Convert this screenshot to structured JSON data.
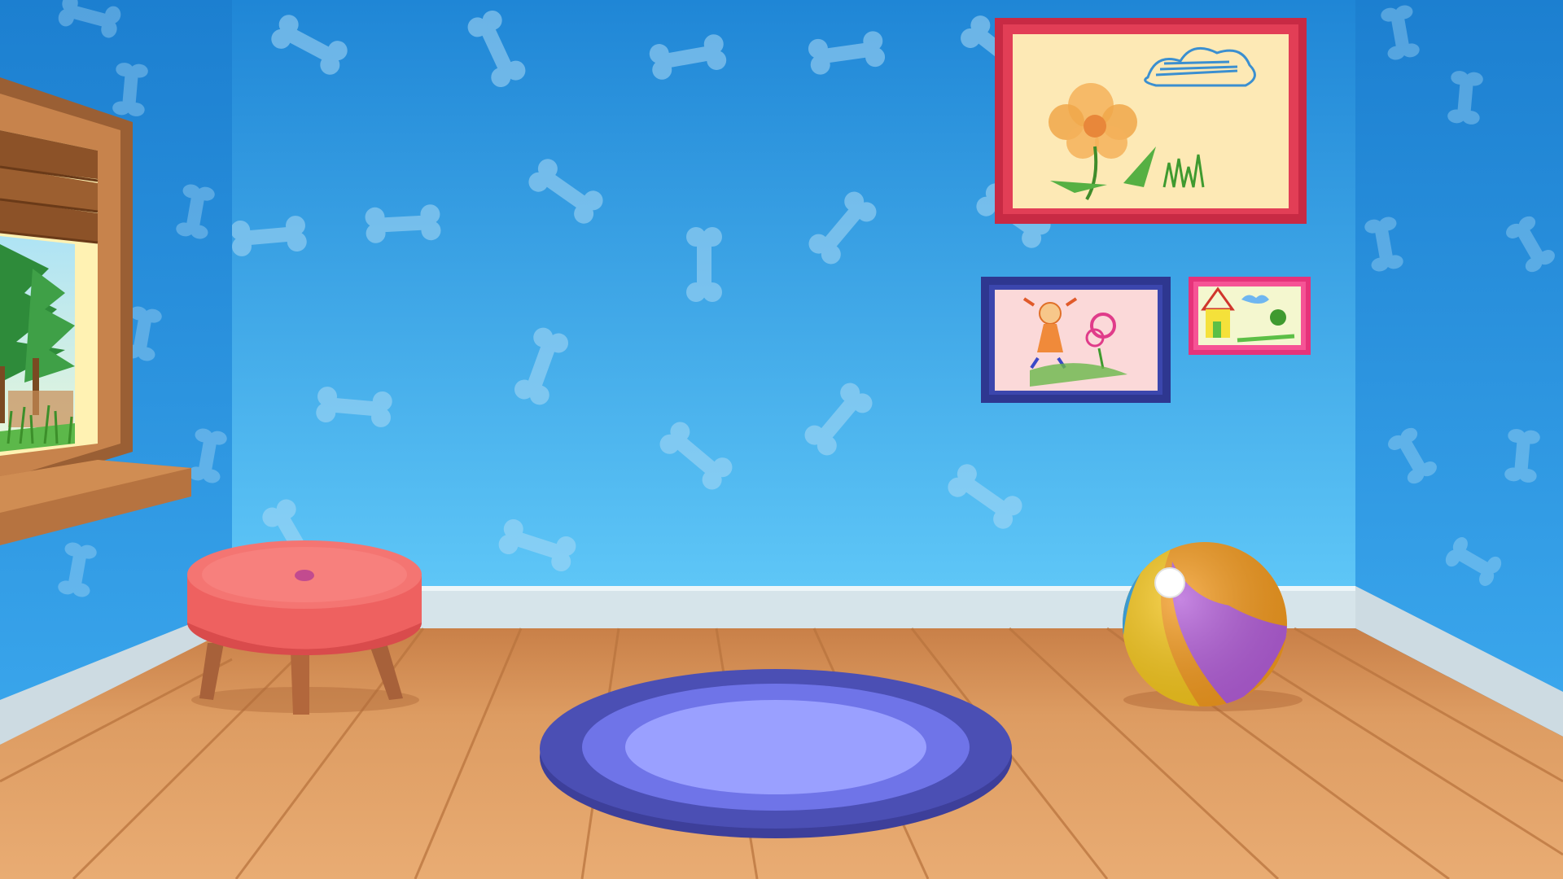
{
  "scene": {
    "room": "kids-room",
    "colors": {
      "wall_top": "#1f86d6",
      "wall_bottom": "#5ec6f7",
      "side_wall": "#2a93e0",
      "bone_pattern": "#9fd3f3",
      "baseboard": "#d9e6ec",
      "floor_light": "#e2a468",
      "floor_dark": "#c97f45",
      "stool_top": "#f36a67",
      "stool_legs": "#b2673c",
      "rug_outer": "#4b4fb4",
      "rug_mid": "#6f74e8",
      "rug_inner": "#9aa0ff",
      "frame_red": "#d6334a",
      "frame_blue": "#323c9a",
      "frame_pink": "#ea3f8a",
      "window_wood": "#a86a3d"
    },
    "objects": [
      {
        "name": "window",
        "icon": "window-icon"
      },
      {
        "name": "stool",
        "icon": "stool-icon"
      },
      {
        "name": "rug",
        "icon": "rug-icon"
      },
      {
        "name": "beach-ball",
        "icon": "ball-icon"
      },
      {
        "name": "flower-drawing",
        "icon": "picture-icon"
      },
      {
        "name": "girl-drawing",
        "icon": "picture-icon"
      },
      {
        "name": "house-drawing",
        "icon": "picture-icon"
      }
    ]
  }
}
